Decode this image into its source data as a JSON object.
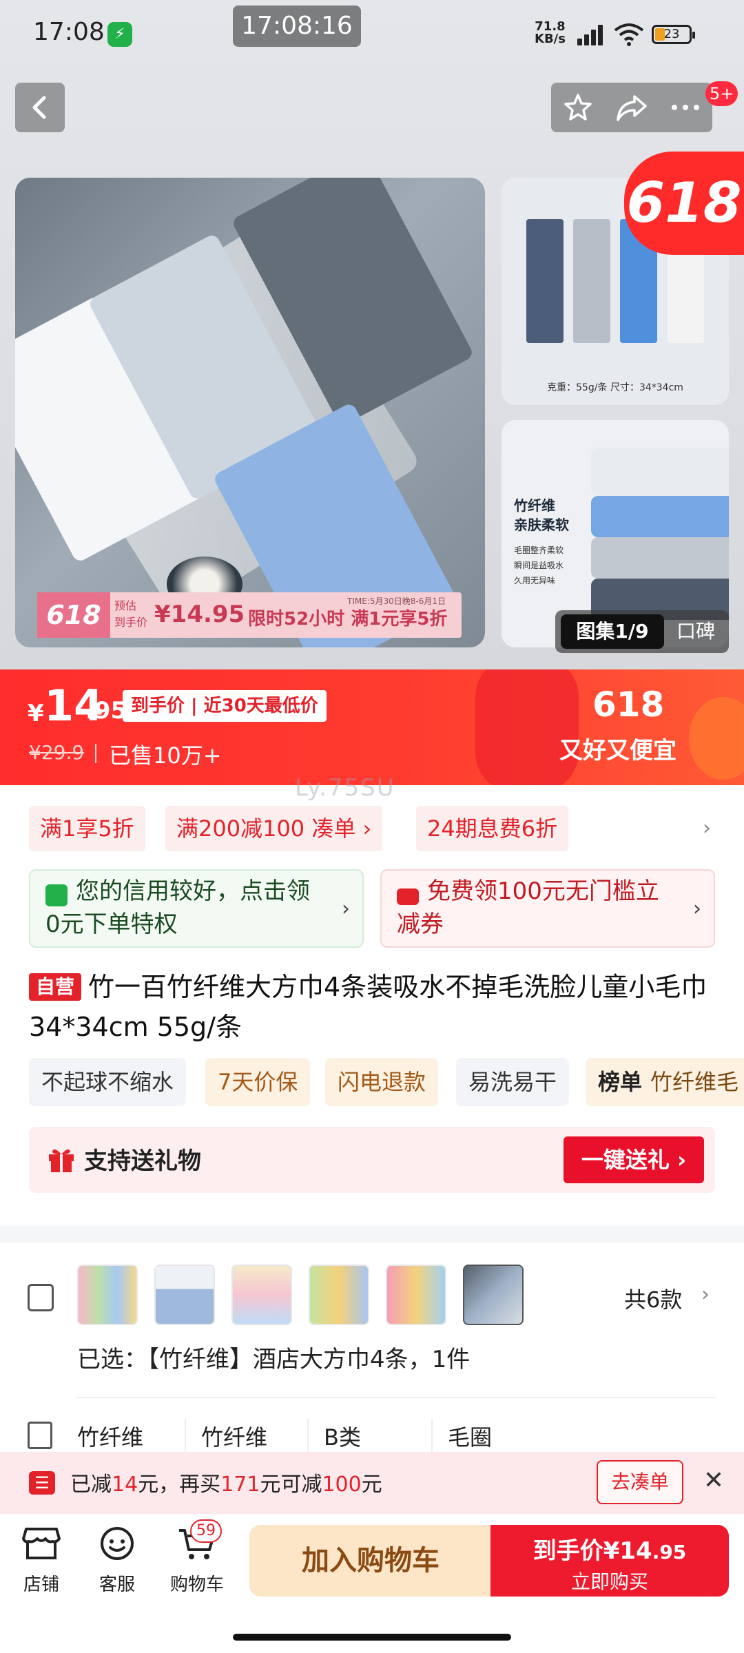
{
  "status_bar": {
    "time": "17:08",
    "center_clock": "17:08:16",
    "net_speed_top": "71.8",
    "net_speed_unit": "KB/s",
    "battery": "23"
  },
  "header": {
    "cart_badge_count": "5+"
  },
  "gallery": {
    "thumb1_caption": "克重：55g/条  尺寸：34*34cm",
    "thumb2_title_line1": "竹纤维",
    "thumb2_title_line2": "亲肤柔软",
    "thumb2_features": [
      "毛圈整齐柔软",
      "瞬间是益吸水",
      "久用无异味"
    ],
    "tag_618": "618",
    "promo_618": "618",
    "promo_est_line1": "预估",
    "promo_est_line2": "到手价",
    "promo_price": "¥14.95",
    "promo_time": "TIME:5月30日晚8-6月1日",
    "promo_limit": "限时52小时 满1元享5折",
    "switch_active": "图集1/9",
    "switch_inactive": "口碑"
  },
  "price_banner": {
    "yen": "¥",
    "price_int": "14",
    "price_dec": ".95",
    "label": "到手价 | 近30天最低价",
    "old_price": "¥29.9",
    "sold": "已售10万+",
    "campaign": "618",
    "slogan": "又好又便宜"
  },
  "watermark": "Ly.75SU",
  "promotions": [
    "满1享5折",
    "满200减100  凑单 ›",
    "24期息费6折"
  ],
  "credit_card": {
    "text": "您的信用较好，点击领0元下单特权",
    "accent": "#22b04b"
  },
  "coupon_card": {
    "text": "免费领100元无门槛立减券",
    "accent": "#e3222a"
  },
  "product": {
    "self_run_badge": "自营",
    "title": "竹一百竹纤维大方巾4条装吸水不掉毛洗脸儿童小毛巾34*34cm 55g/条"
  },
  "features": [
    {
      "label": "不起球不缩水",
      "style": "grey"
    },
    {
      "label": "7天价保",
      "style": "orange"
    },
    {
      "label": "闪电退款",
      "style": "orange"
    },
    {
      "label": "易洗易干",
      "style": "grey"
    }
  ],
  "rank": {
    "prefix": "榜单",
    "label": "竹纤维毛"
  },
  "gift": {
    "text": "支持送礼物",
    "button": "一键送礼 ›"
  },
  "sku": {
    "count": "共6款",
    "selected": "已选：【竹纤维】酒店大方巾4条，1件"
  },
  "attributes": [
    "竹纤维",
    "竹纤维",
    "B类",
    "毛圈"
  ],
  "coupon_toast": {
    "prefix": "已减",
    "reduced": "14",
    "mid1": "元，再买",
    "need": "171",
    "mid2": "元可减",
    "benefit": "100",
    "suffix": "元",
    "button": "去凑单"
  },
  "bottom_nav": {
    "store": "店铺",
    "service": "客服",
    "cart": "购物车",
    "cart_count": "59",
    "add_cart": "加入购物车",
    "buy_label": "到手价",
    "buy_price_int": "¥14",
    "buy_price_dec": ".95",
    "buy_now": "立即购买"
  },
  "colors": {
    "brand_red": "#e3222a",
    "banner_red": "#ff2d2d",
    "add_cart_bg": "#fde6c7"
  }
}
